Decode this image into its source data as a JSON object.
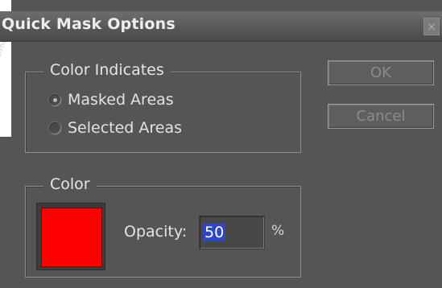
{
  "dialog": {
    "title": "Quick Mask Options",
    "close_glyph": "×"
  },
  "color_indicates": {
    "legend": "Color Indicates",
    "options": [
      {
        "label": "Masked Areas",
        "checked": true
      },
      {
        "label": "Selected Areas",
        "checked": false
      }
    ]
  },
  "color_group": {
    "legend": "Color",
    "swatch_color": "#ff0000",
    "opacity_label": "Opacity:",
    "opacity_value": "50",
    "opacity_unit": "%"
  },
  "buttons": {
    "ok": "OK",
    "cancel": "Cancel"
  },
  "theme": {
    "dialog_bg": "#555555",
    "selection_highlight": "#2f47c6"
  }
}
